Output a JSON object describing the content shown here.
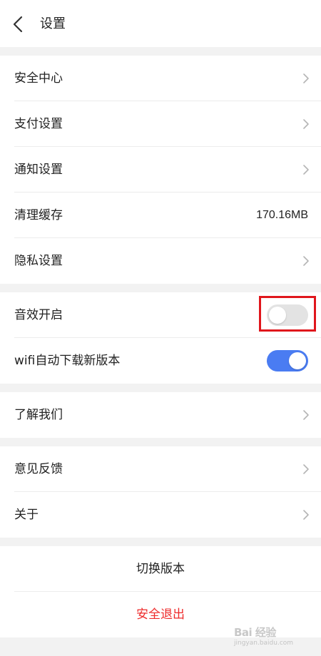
{
  "header": {
    "title": "设置",
    "back_icon": "back-chevron-icon"
  },
  "groups": {
    "account": [
      {
        "label": "安全中心",
        "action": "chevron"
      },
      {
        "label": "支付设置",
        "action": "chevron"
      },
      {
        "label": "通知设置",
        "action": "chevron"
      },
      {
        "label": "清理缓存",
        "value": "170.16MB"
      },
      {
        "label": "隐私设置",
        "action": "chevron"
      }
    ],
    "toggles": [
      {
        "label": "音效开启",
        "state": "off"
      },
      {
        "label": "wifi自动下载新版本",
        "state": "on"
      }
    ],
    "about": [
      {
        "label": "了解我们",
        "action": "chevron"
      }
    ],
    "feedback": [
      {
        "label": "意见反馈",
        "action": "chevron"
      },
      {
        "label": "关于",
        "action": "chevron"
      }
    ],
    "actions": {
      "switch_version": "切换版本",
      "logout": "安全退出"
    }
  },
  "colors": {
    "toggle_on": "#4a7cf2",
    "toggle_off": "#e3e3e3",
    "logout_text": "#ee2b2b",
    "highlight_box": "#e0161c",
    "background": "#f2f2f2"
  },
  "watermark": {
    "brand": "Bai 经验",
    "domain": "jingyan.baidu.com"
  }
}
